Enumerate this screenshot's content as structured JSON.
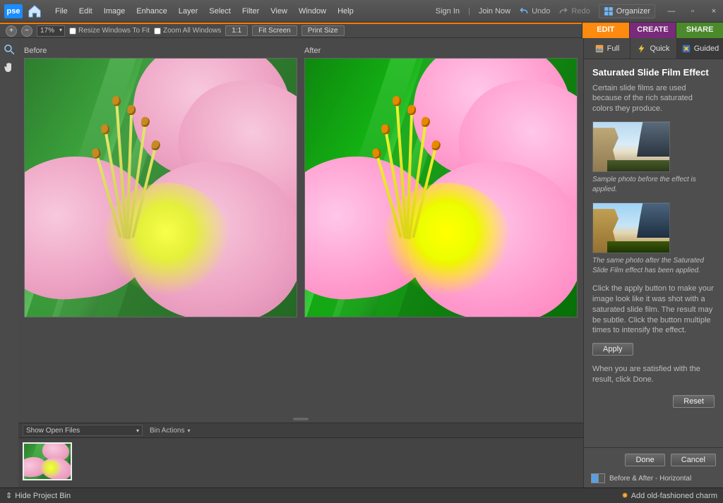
{
  "app": {
    "logo": "pse"
  },
  "menu": {
    "items": [
      "File",
      "Edit",
      "Image",
      "Enhance",
      "Layer",
      "Select",
      "Filter",
      "View",
      "Window",
      "Help"
    ]
  },
  "topRight": {
    "signIn": "Sign In",
    "joinNow": "Join Now",
    "undo": "Undo",
    "redo": "Redo",
    "organizer": "Organizer"
  },
  "options": {
    "zoom": "17%",
    "resizeWindows": "Resize Windows To Fit",
    "zoomAll": "Zoom All Windows",
    "oneToOne": "1:1",
    "fitScreen": "Fit Screen",
    "printSize": "Print Size"
  },
  "mainTabs": {
    "edit": "EDIT",
    "create": "CREATE",
    "share": "SHARE"
  },
  "subTabs": {
    "full": "Full",
    "quick": "Quick",
    "guided": "Guided",
    "active": "guided"
  },
  "beforeAfter": {
    "before": "Before",
    "after": "After"
  },
  "projectBin": {
    "showOpen": "Show Open Files",
    "binActions": "Bin Actions"
  },
  "guided": {
    "title": "Saturated Slide Film Effect",
    "intro": "Certain slide films are used because of the rich saturated colors they produce.",
    "captionBefore": "Sample photo before the effect is applied.",
    "captionAfter": "The same photo after the Saturated Slide Film effect has been applied.",
    "instructions": "Click the apply button to make your image look like it was shot with a saturated slide film. The result may be subtle. Click the button multiple times to intensify the effect.",
    "apply": "Apply",
    "satisfied": "When you are satisfied with the result, click Done.",
    "reset": "Reset",
    "done": "Done",
    "cancel": "Cancel",
    "viewMode": "Before & After - Horizontal"
  },
  "statusbar": {
    "hideBin": "Hide Project Bin",
    "tip": "Add old-fashioned charm"
  }
}
